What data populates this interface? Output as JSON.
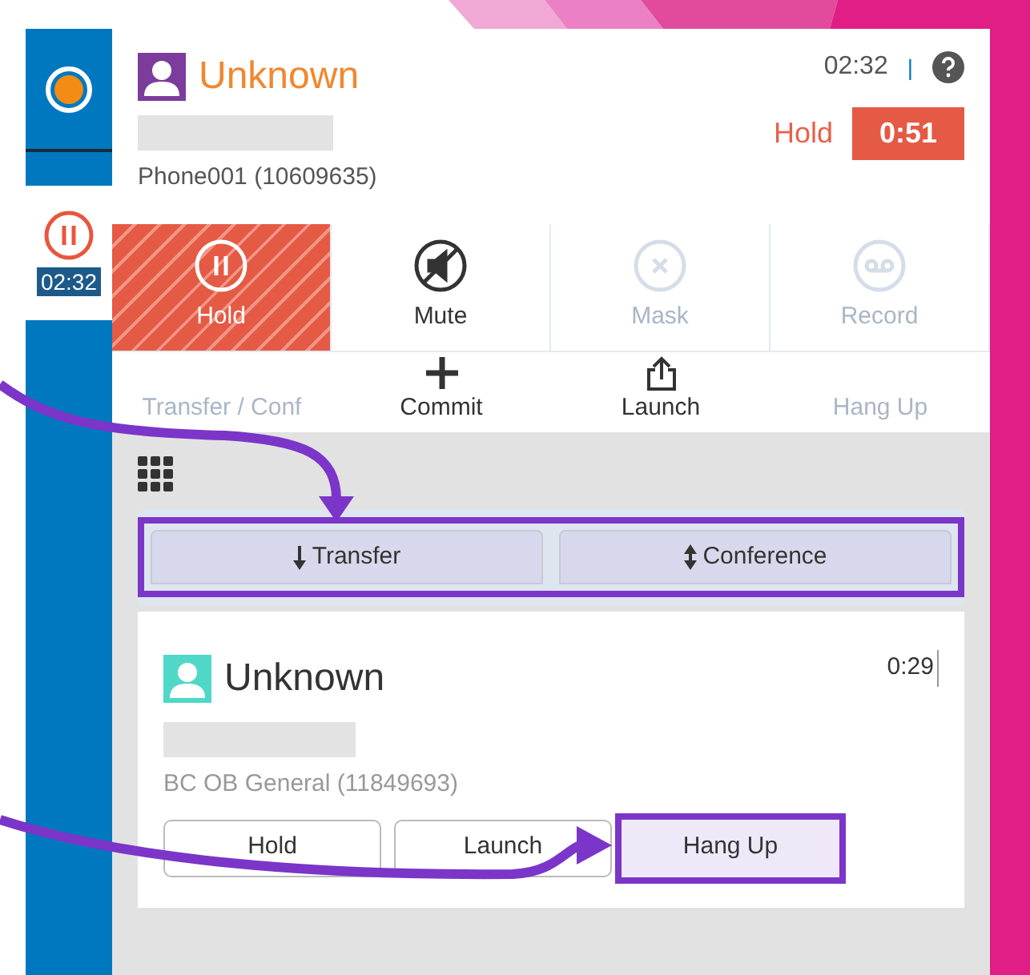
{
  "sidebar": {
    "items": [
      {
        "kind": "status",
        "selected": false
      },
      {
        "kind": "call",
        "selected": true,
        "time": "02:32"
      }
    ]
  },
  "call": {
    "name": "Unknown",
    "number_redacted": true,
    "line": "Phone001 (10609635)",
    "elapsed": "02:32",
    "separator": "|",
    "hold_label": "Hold",
    "hold_time": "0:51"
  },
  "actions": [
    {
      "label": "Hold",
      "active": true,
      "disabled": false
    },
    {
      "label": "Mute",
      "active": false,
      "disabled": false
    },
    {
      "label": "Mask",
      "active": false,
      "disabled": true
    },
    {
      "label": "Record",
      "active": false,
      "disabled": true
    },
    {
      "label": "Transfer / Conf",
      "active": false,
      "disabled": true
    },
    {
      "label": "Commit",
      "active": false,
      "disabled": false
    },
    {
      "label": "Launch",
      "active": false,
      "disabled": false
    },
    {
      "label": "Hang Up",
      "active": false,
      "disabled": true
    }
  ],
  "transfer_bar": {
    "highlighted": true,
    "tabs": [
      {
        "label": "Transfer"
      },
      {
        "label": "Conference"
      }
    ]
  },
  "consult_call": {
    "name": "Unknown",
    "time": "0:29",
    "line": "BC OB General (11849693)",
    "buttons": [
      {
        "label": "Hold",
        "highlighted": false
      },
      {
        "label": "Launch",
        "highlighted": false
      },
      {
        "label": "Hang Up",
        "highlighted": true
      }
    ]
  }
}
